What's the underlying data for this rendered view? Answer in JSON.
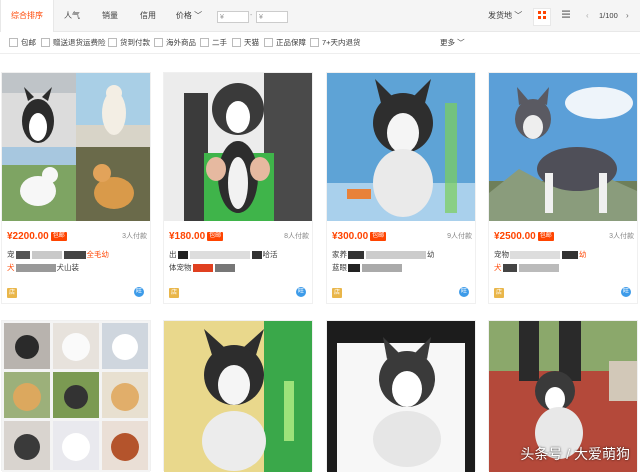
{
  "sort_bar": {
    "items": [
      {
        "label": "综合排序",
        "active": true
      },
      {
        "label": "人气"
      },
      {
        "label": "销量"
      },
      {
        "label": "信用"
      },
      {
        "label": "价格 ﹀"
      }
    ],
    "price_min": "¥",
    "price_max": "¥",
    "dash": "-",
    "location": "发货地 ﹀",
    "page": "1/100",
    "prev": "‹",
    "next": "›"
  },
  "filters": {
    "items": [
      "包邮",
      "赠送退货运费险",
      "货到付款",
      "海外商品",
      "二手",
      "天猫",
      "正品保障",
      "7+天内退货"
    ],
    "more": "更多 ﹀"
  },
  "products": [
    {
      "price": "¥2200.00",
      "ship": "包邮",
      "buyers": "3人付款",
      "line1": "宠",
      "line1b": "全毛幼",
      "line2": "犬",
      "line2b": "犬山装",
      "shop": "店",
      "ww": "旺"
    },
    {
      "price": "¥180.00",
      "ship": "包邮",
      "buyers": "8人付款",
      "line1": "出",
      "line1b": "哈活",
      "line2": "体宠物",
      "line2b": "",
      "shop": "店",
      "ww": "旺"
    },
    {
      "price": "¥300.00",
      "ship": "包邮",
      "buyers": "9人付款",
      "line1": "家养",
      "line1b": "幼",
      "line2": "蓝眼",
      "line2b": "",
      "shop": "店",
      "ww": "旺"
    },
    {
      "price": "¥2500.00",
      "ship": "包邮",
      "buyers": "3人付款",
      "line1": "宠物",
      "line1b": "幼",
      "line2": "犬",
      "line2b": "",
      "shop": "店",
      "ww": "旺"
    }
  ],
  "watermark": "头条号 / 大爱萌狗",
  "colors": {
    "accent": "#ff4400",
    "husky_gray": "#5f5f66",
    "sky": "#6fa6d8"
  }
}
